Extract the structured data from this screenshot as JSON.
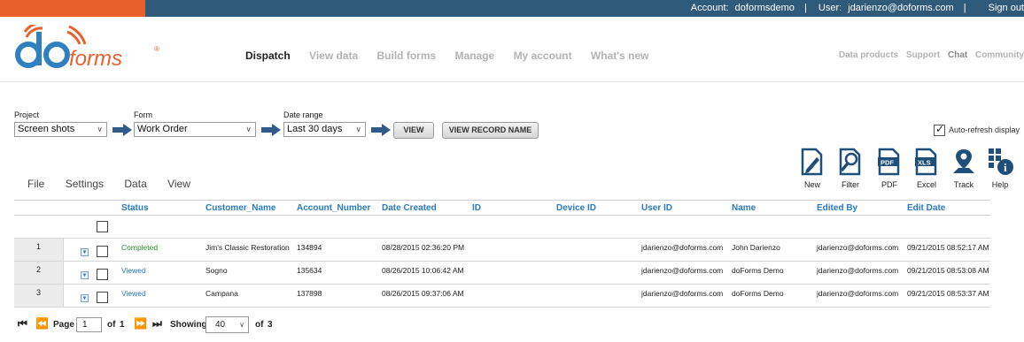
{
  "topbar": {
    "account_label": "Account:",
    "account_value": "doformsdemo",
    "separator": "|",
    "user_label": "User:",
    "user_value": "jdarienzo@doforms.com",
    "separator2": "|",
    "signout": "Sign out"
  },
  "logo": {
    "do": "do",
    "forms": "forms",
    "reg": "®"
  },
  "nav": {
    "items": [
      {
        "label": "Dispatch"
      },
      {
        "label": "View data"
      },
      {
        "label": "Build forms"
      },
      {
        "label": "Manage"
      },
      {
        "label": "My account"
      },
      {
        "label": "What's new"
      }
    ],
    "secondary": [
      {
        "label": "Data products"
      },
      {
        "label": "Support"
      },
      {
        "label": "Chat"
      },
      {
        "label": "Community"
      }
    ]
  },
  "filters": {
    "project_label": "Project",
    "project_value": "Screen shots",
    "form_label": "Form",
    "form_value": "Work Order",
    "date_label": "Date range",
    "date_value": "Last 30 days",
    "view_button": "VIEW",
    "view_record_button": "VIEW RECORD NAME",
    "auto_refresh": "Auto-refresh display"
  },
  "tools": [
    {
      "label": "New",
      "icon": "new-icon"
    },
    {
      "label": "Filter",
      "icon": "filter-icon"
    },
    {
      "label": "PDF",
      "icon": "pdf-icon"
    },
    {
      "label": "Excel",
      "icon": "excel-icon"
    },
    {
      "label": "Track",
      "icon": "track-icon"
    },
    {
      "label": "Help",
      "icon": "help-icon"
    }
  ],
  "menu": [
    {
      "label": "File"
    },
    {
      "label": "Settings"
    },
    {
      "label": "Data"
    },
    {
      "label": "View"
    }
  ],
  "table": {
    "columns": [
      "Status",
      "Customer_Name",
      "Account_Number",
      "Date Created",
      "ID",
      "Device ID",
      "User ID",
      "Name",
      "Edited By",
      "Edit Date"
    ],
    "rows": [
      {
        "num": "1",
        "status": "Completed",
        "customer": "Jim's Classic Restoration",
        "account": "134894",
        "date_created": "08/28/2015 02:36:20 PM",
        "id": "",
        "device_id": "",
        "user_id": "jdarienzo@doforms.com",
        "name": "John Darienzo",
        "edited_by": "jdarienzo@doforms.com",
        "edit_date": "09/21/2015 08:52:17 AM"
      },
      {
        "num": "2",
        "status": "Viewed",
        "customer": "Sogno",
        "account": "135634",
        "date_created": "08/26/2015 10:06:42 AM",
        "id": "",
        "device_id": "",
        "user_id": "jdarienzo@doforms.com",
        "name": "doForms Demo",
        "edited_by": "jdarienzo@doforms.com",
        "edit_date": "09/21/2015 08:53:08 AM"
      },
      {
        "num": "3",
        "status": "Viewed",
        "customer": "Campana",
        "account": "137898",
        "date_created": "08/26/2015 09:37:06 AM",
        "id": "",
        "device_id": "",
        "user_id": "jdarienzo@doforms.com",
        "name": "doForms Demo",
        "edited_by": "jdarienzo@doforms.com",
        "edit_date": "09/21/2015 08:53:37 AM"
      }
    ]
  },
  "pager": {
    "page_label": "Page",
    "page_value": "1",
    "of_label": "of",
    "total_pages": "1",
    "showing_label": "Showing",
    "showing_value": "40",
    "of_label2": "of",
    "total_records": "3"
  },
  "colors": {
    "topbar": "#2f5a7a",
    "topbar_accent": "#e8602c",
    "link": "#2a7bc4",
    "completed": "#2c8a2c",
    "arrow": "#2f5a8a"
  }
}
